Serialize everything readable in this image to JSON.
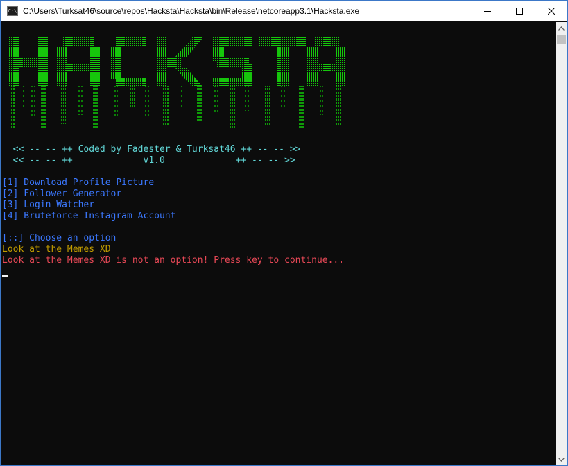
{
  "window": {
    "title": "C:\\Users\\Turksat46\\source\\repos\\Hacksta\\Hacksta\\bin\\Release\\netcoreapp3.1\\Hacksta.exe",
    "app_icon_text": "C:\\",
    "buttons": [
      "minimize-icon",
      "maximize-icon",
      "close-icon"
    ]
  },
  "console": {
    "banner": {
      "text": "HACKSTA",
      "color": "#16c60c",
      "style": "ascii-art with dripping dotted trails"
    },
    "credits": {
      "line1": "  << -- -- ++ Coded by Fadester & Turksat46 ++ -- -- >>",
      "line2": "  << -- -- ++             v1.0             ++ -- -- >>"
    },
    "menu": [
      "[1] Download Profile Picture",
      "[2] Follower Generator",
      "[3] Login Watcher",
      "[4] Bruteforce Instagram Account"
    ],
    "prompt": "[::] Choose an option",
    "user_input": "Look at the Memes XD",
    "error": "Look at the Memes XD is not an option! Press key to continue...",
    "colors": {
      "background": "#0c0c0c",
      "credits": "#61d6d6",
      "menu": "#3b78ff",
      "input": "#c19c00",
      "error": "#e74856"
    }
  }
}
